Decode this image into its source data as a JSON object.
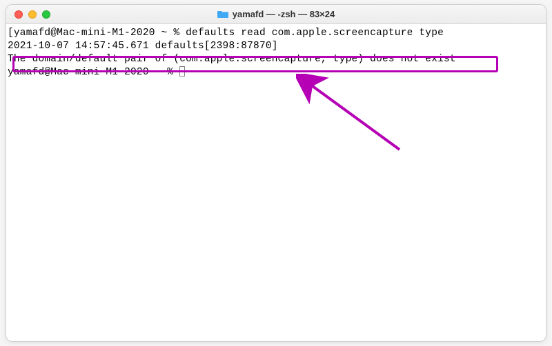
{
  "window": {
    "title": "yamafd — -zsh — 83×24",
    "folder_icon": "folder"
  },
  "terminal": {
    "line1_prefix": "[",
    "line1_prompt": "yamafd@Mac-mini-M1-2020 ~ % ",
    "line1_cmd": "defaults read com.apple.screencapture type",
    "line2": "2021-10-07 14:57:45.671 defaults[2398:87870]",
    "line3": "The domain/default pair of (com.apple.screencapture, type) does not exist",
    "line4_prompt": "yamafd@Mac-mini-M1-2020 ~ % "
  },
  "annotation": {
    "color": "#b500b5"
  }
}
